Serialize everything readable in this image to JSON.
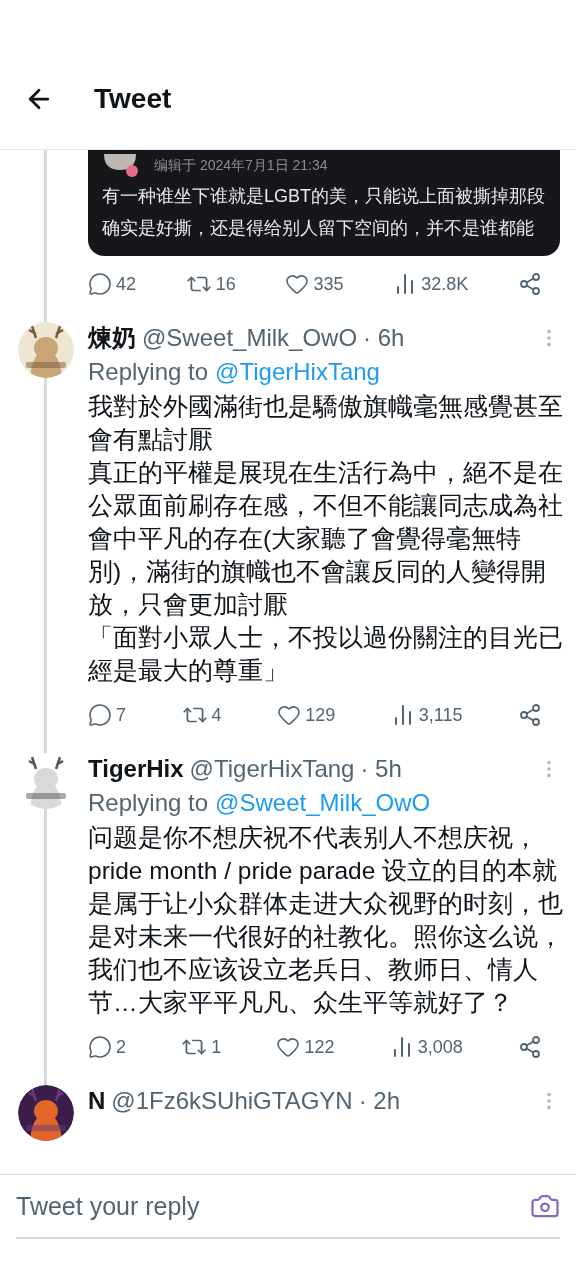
{
  "header": {
    "title": "Tweet"
  },
  "quoted_image": {
    "edited": "编辑于 2024年7月1日 21:34",
    "lines": [
      "有一种谁坐下谁就是LGBT的美，只能说上面被撕掉那段",
      "确实是好撕，还是得给别人留下空间的，并不是谁都能"
    ]
  },
  "top_stats": {
    "replies": "42",
    "retweets": "16",
    "likes": "335",
    "views": "32.8K"
  },
  "replies": [
    {
      "name": "煉奶",
      "handle": "@Sweet_Milk_OwO",
      "time": "· 6h",
      "replying_label": "Replying to",
      "replying_to": "@TigerHixTang",
      "paragraphs": [
        "我對於外國滿街也是驕傲旗幟毫無感覺甚至會有點討厭",
        "真正的平權是展現在生活行為中，絕不是在公眾面前刷存在感，不但不能讓同志成為社會中平凡的存在(大家聽了會覺得毫無特別)，滿街的旗幟也不會讓反同的人變得開放，只會更加討厭",
        "「面對小眾人士，不投以過份關注的目光已經是最大的尊重」"
      ],
      "stats": {
        "replies": "7",
        "retweets": "4",
        "likes": "129",
        "views": "3,115"
      }
    },
    {
      "name": "TigerHix",
      "handle": "@TigerHixTang",
      "time": "· 5h",
      "replying_label": "Replying to",
      "replying_to": "@Sweet_Milk_OwO",
      "paragraphs": [
        "问题是你不想庆祝不代表别人不想庆祝，pride month / pride parade 设立的目的本就是属于让小众群体走进大众视野的时刻，也是对未来一代很好的社教化。照你这么说，我们也不应该设立老兵日、教师日、情人节…大家平平凡凡、众生平等就好了？"
      ],
      "stats": {
        "replies": "2",
        "retweets": "1",
        "likes": "122",
        "views": "3,008"
      }
    },
    {
      "name": "N",
      "handle": "@1Fz6kSUhiGTAGYN",
      "time": "· 2h"
    }
  ],
  "composer": {
    "placeholder": "Tweet your reply"
  }
}
